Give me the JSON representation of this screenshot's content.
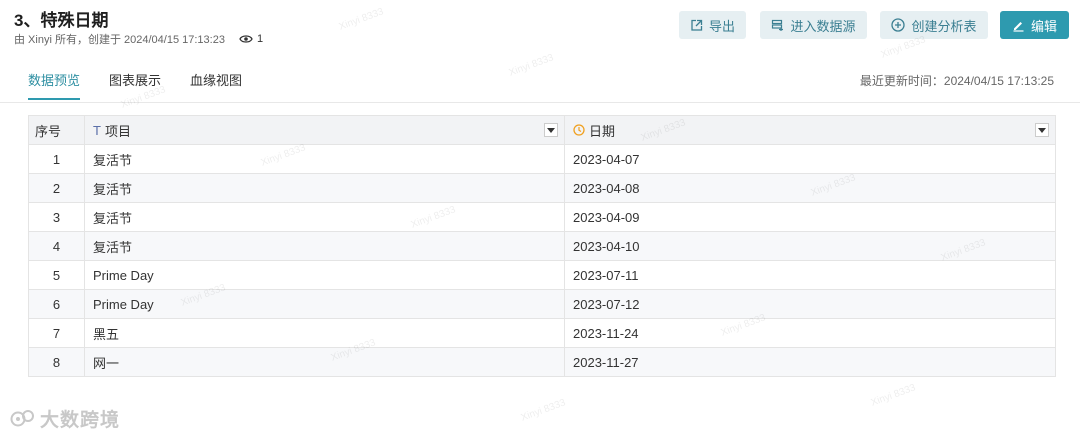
{
  "header": {
    "title": "3、特殊日期",
    "meta": "由 Xinyi 所有，创建于 2024/04/15 17:13:23",
    "views": "1"
  },
  "toolbar": {
    "export_label": "导出",
    "datasource_label": "进入数据源",
    "create_analysis_label": "创建分析表",
    "edit_label": "编辑"
  },
  "tabs": [
    {
      "label": "数据预览"
    },
    {
      "label": "图表展示"
    },
    {
      "label": "血缘视图"
    }
  ],
  "updated": "最近更新时间：2024/04/15 17:13:25",
  "table": {
    "headers": {
      "index": "序号",
      "item": "项目",
      "date": "日期"
    },
    "rows": [
      {
        "index": "1",
        "item": "复活节",
        "date": "2023-04-07"
      },
      {
        "index": "2",
        "item": "复活节",
        "date": "2023-04-08"
      },
      {
        "index": "3",
        "item": "复活节",
        "date": "2023-04-09"
      },
      {
        "index": "4",
        "item": "复活节",
        "date": "2023-04-10"
      },
      {
        "index": "5",
        "item": "Prime Day",
        "date": "2023-07-11"
      },
      {
        "index": "6",
        "item": "Prime Day",
        "date": "2023-07-12"
      },
      {
        "index": "7",
        "item": "黑五",
        "date": "2023-11-24"
      },
      {
        "index": "8",
        "item": "网一",
        "date": "2023-11-27"
      }
    ]
  },
  "watermark": "Xinyi 8333",
  "logo": {
    "text": "大数跨境"
  },
  "colors": {
    "accent": "#2e9aaf",
    "button_light_bg": "#e6eff2",
    "date_icon": "#f0a020"
  }
}
